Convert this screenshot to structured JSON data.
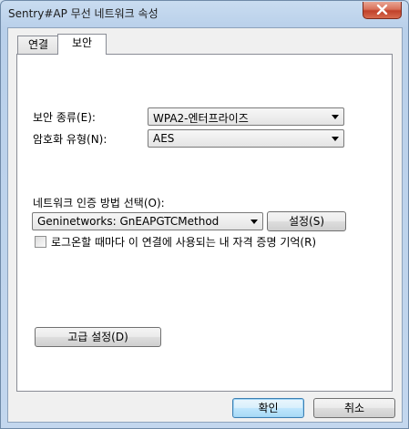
{
  "window": {
    "title": "Sentry#AP 무선 네트워크 속성"
  },
  "tabs": [
    {
      "label": "연결",
      "active": false
    },
    {
      "label": "보안",
      "active": true
    }
  ],
  "security": {
    "type_label": "보안 종류(E):",
    "type_value": "WPA2-엔터프라이즈",
    "encryption_label": "암호화 유형(N):",
    "encryption_value": "AES",
    "auth_method_label": "네트워크 인증 방법 선택(O):",
    "auth_method_value": "Geninetworks: GnEAPGTCMethod",
    "settings_button": "설정(S)",
    "remember_checkbox_label": "로그온할 때마다 이 연결에 사용되는 내 자격 증명 기억(R)",
    "remember_checked": false,
    "advanced_button": "고급 설정(D)"
  },
  "footer": {
    "ok_button": "확인",
    "cancel_button": "취소"
  },
  "icons": {
    "close": "close-icon",
    "dropdown": "chevron-down-icon"
  }
}
